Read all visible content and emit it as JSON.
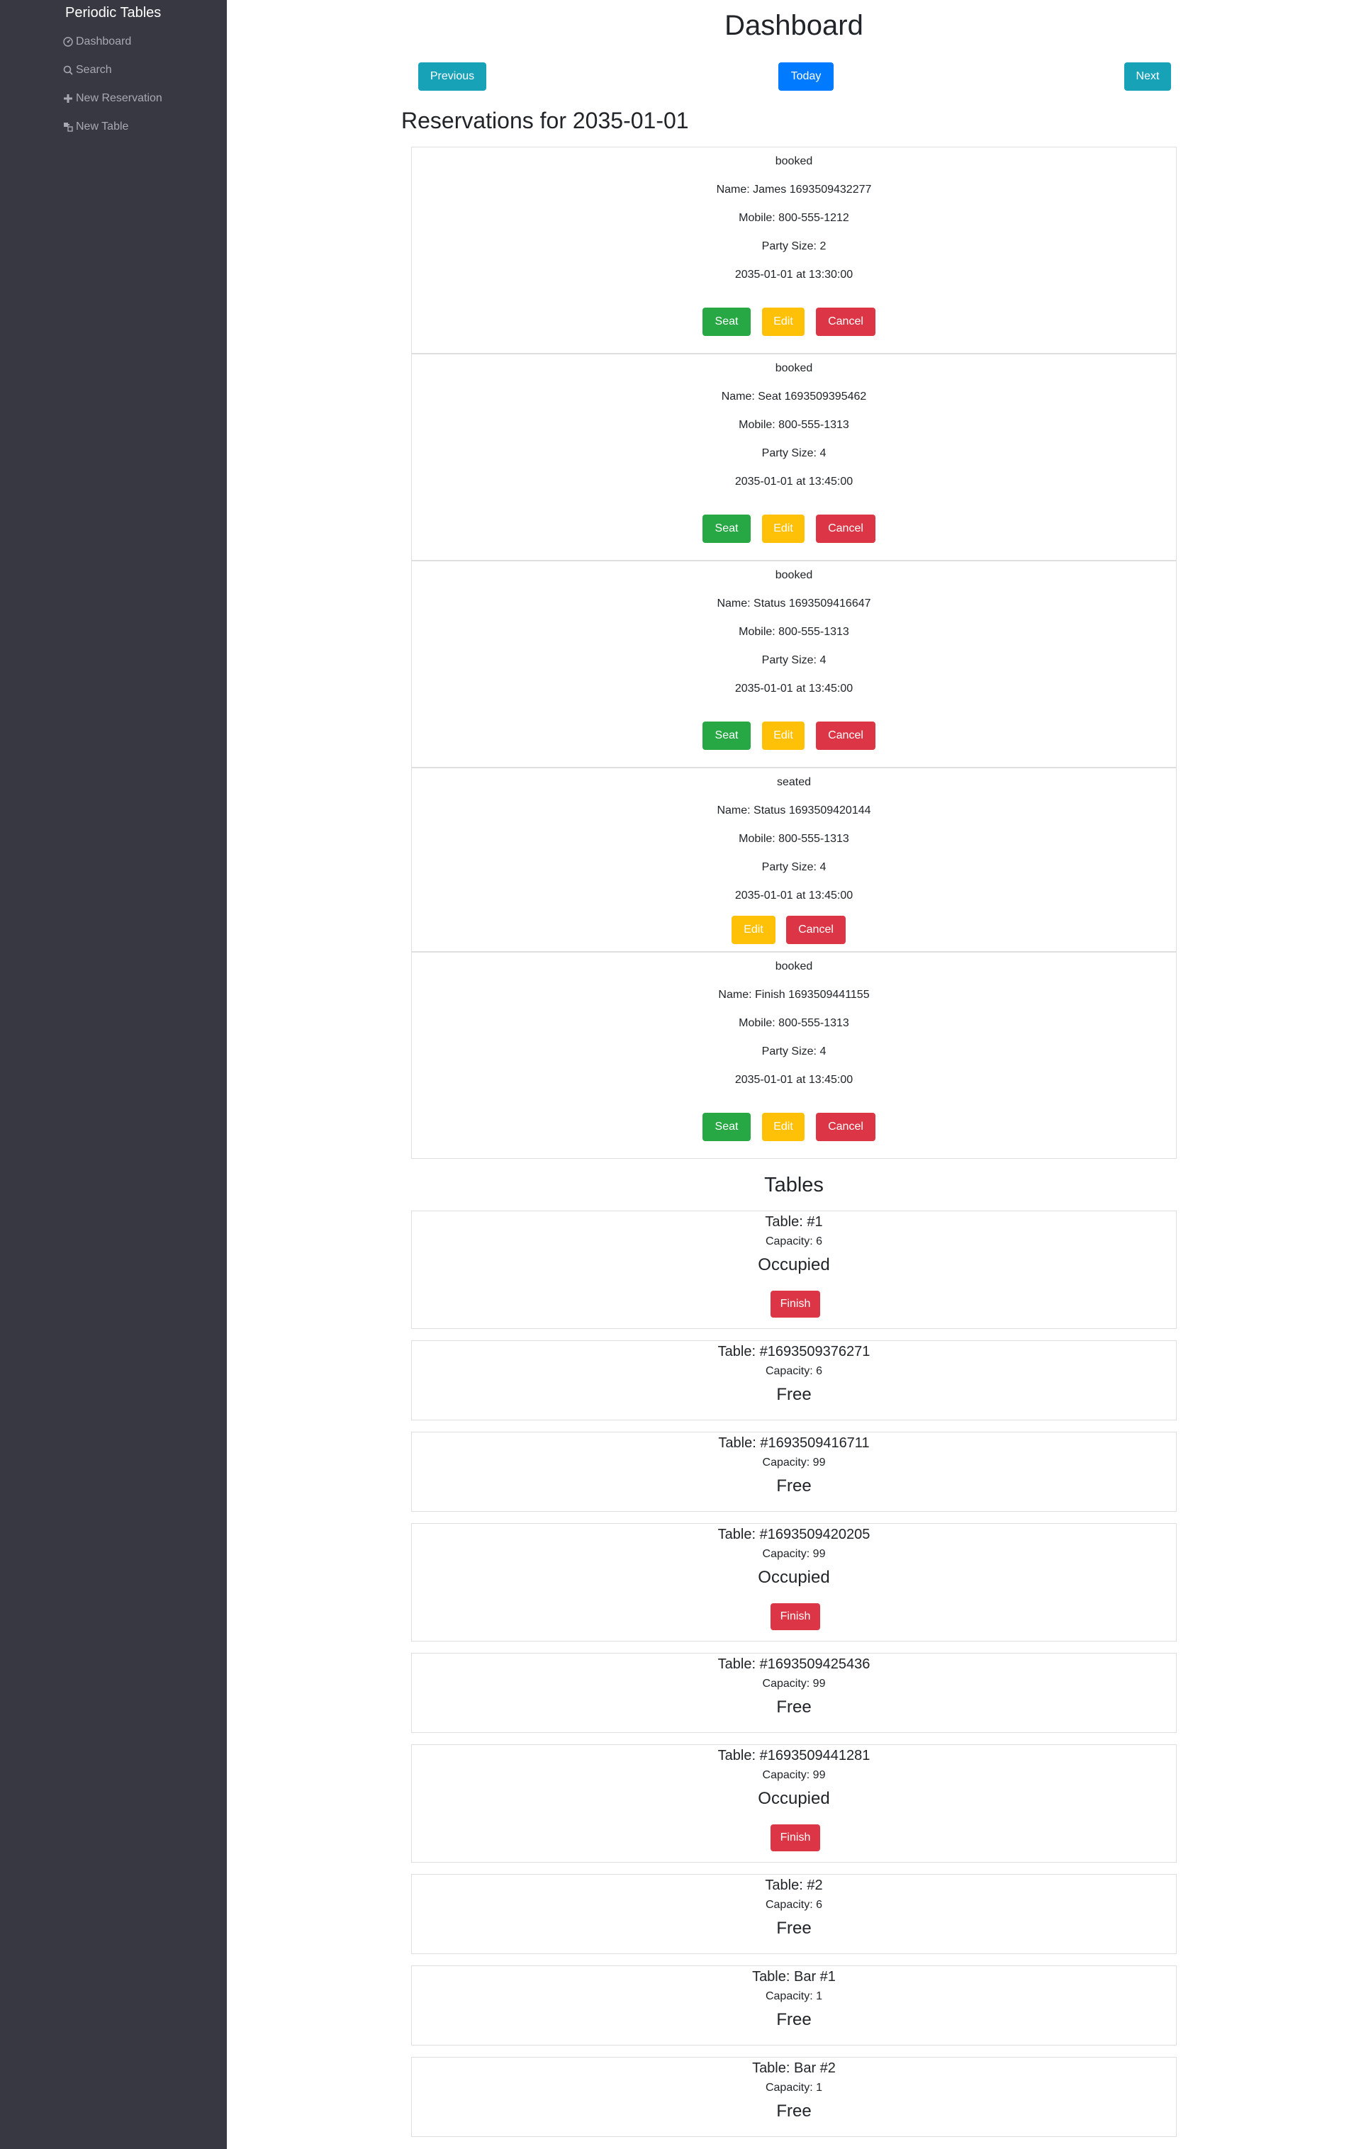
{
  "sidebar": {
    "brand": "Periodic Tables",
    "items": [
      {
        "label": "Dashboard",
        "icon": "dashboard-icon"
      },
      {
        "label": "Search",
        "icon": "search-icon"
      },
      {
        "label": "New Reservation",
        "icon": "plus-icon"
      },
      {
        "label": "New Table",
        "icon": "table-icon"
      }
    ]
  },
  "header": {
    "title": "Dashboard",
    "previous_label": "Previous",
    "today_label": "Today",
    "next_label": "Next"
  },
  "reservations": {
    "heading": "Reservations for 2035-01-01",
    "seat_label": "Seat",
    "edit_label": "Edit",
    "cancel_label": "Cancel",
    "items": [
      {
        "status": "booked",
        "name": "Name: James 1693509432277",
        "mobile": "Mobile: 800-555-1212",
        "party": "Party Size: 2",
        "datetime": "2035-01-01 at 13:30:00"
      },
      {
        "status": "booked",
        "name": "Name: Seat 1693509395462",
        "mobile": "Mobile: 800-555-1313",
        "party": "Party Size: 4",
        "datetime": "2035-01-01 at 13:45:00"
      },
      {
        "status": "booked",
        "name": "Name: Status 1693509416647",
        "mobile": "Mobile: 800-555-1313",
        "party": "Party Size: 4",
        "datetime": "2035-01-01 at 13:45:00"
      },
      {
        "status": "seated",
        "name": "Name: Status 1693509420144",
        "mobile": "Mobile: 800-555-1313",
        "party": "Party Size: 4",
        "datetime": "2035-01-01 at 13:45:00"
      },
      {
        "status": "booked",
        "name": "Name: Finish 1693509441155",
        "mobile": "Mobile: 800-555-1313",
        "party": "Party Size: 4",
        "datetime": "2035-01-01 at 13:45:00"
      }
    ]
  },
  "tables": {
    "heading": "Tables",
    "finish_label": "Finish",
    "items": [
      {
        "title": "Table: #1",
        "capacity": "Capacity: 6",
        "status": "Occupied"
      },
      {
        "title": "Table: #1693509376271",
        "capacity": "Capacity: 6",
        "status": "Free"
      },
      {
        "title": "Table: #1693509416711",
        "capacity": "Capacity: 99",
        "status": "Free"
      },
      {
        "title": "Table: #1693509420205",
        "capacity": "Capacity: 99",
        "status": "Occupied"
      },
      {
        "title": "Table: #1693509425436",
        "capacity": "Capacity: 99",
        "status": "Free"
      },
      {
        "title": "Table: #1693509441281",
        "capacity": "Capacity: 99",
        "status": "Occupied"
      },
      {
        "title": "Table: #2",
        "capacity": "Capacity: 6",
        "status": "Free"
      },
      {
        "title": "Table: Bar #1",
        "capacity": "Capacity: 1",
        "status": "Free"
      },
      {
        "title": "Table: Bar #2",
        "capacity": "Capacity: 1",
        "status": "Free"
      }
    ]
  },
  "colors": {
    "sidebar_bg": "#383843",
    "info": "#17a2b8",
    "primary": "#007bff",
    "success": "#28a745",
    "warning": "#ffc107",
    "danger": "#dc3545"
  }
}
